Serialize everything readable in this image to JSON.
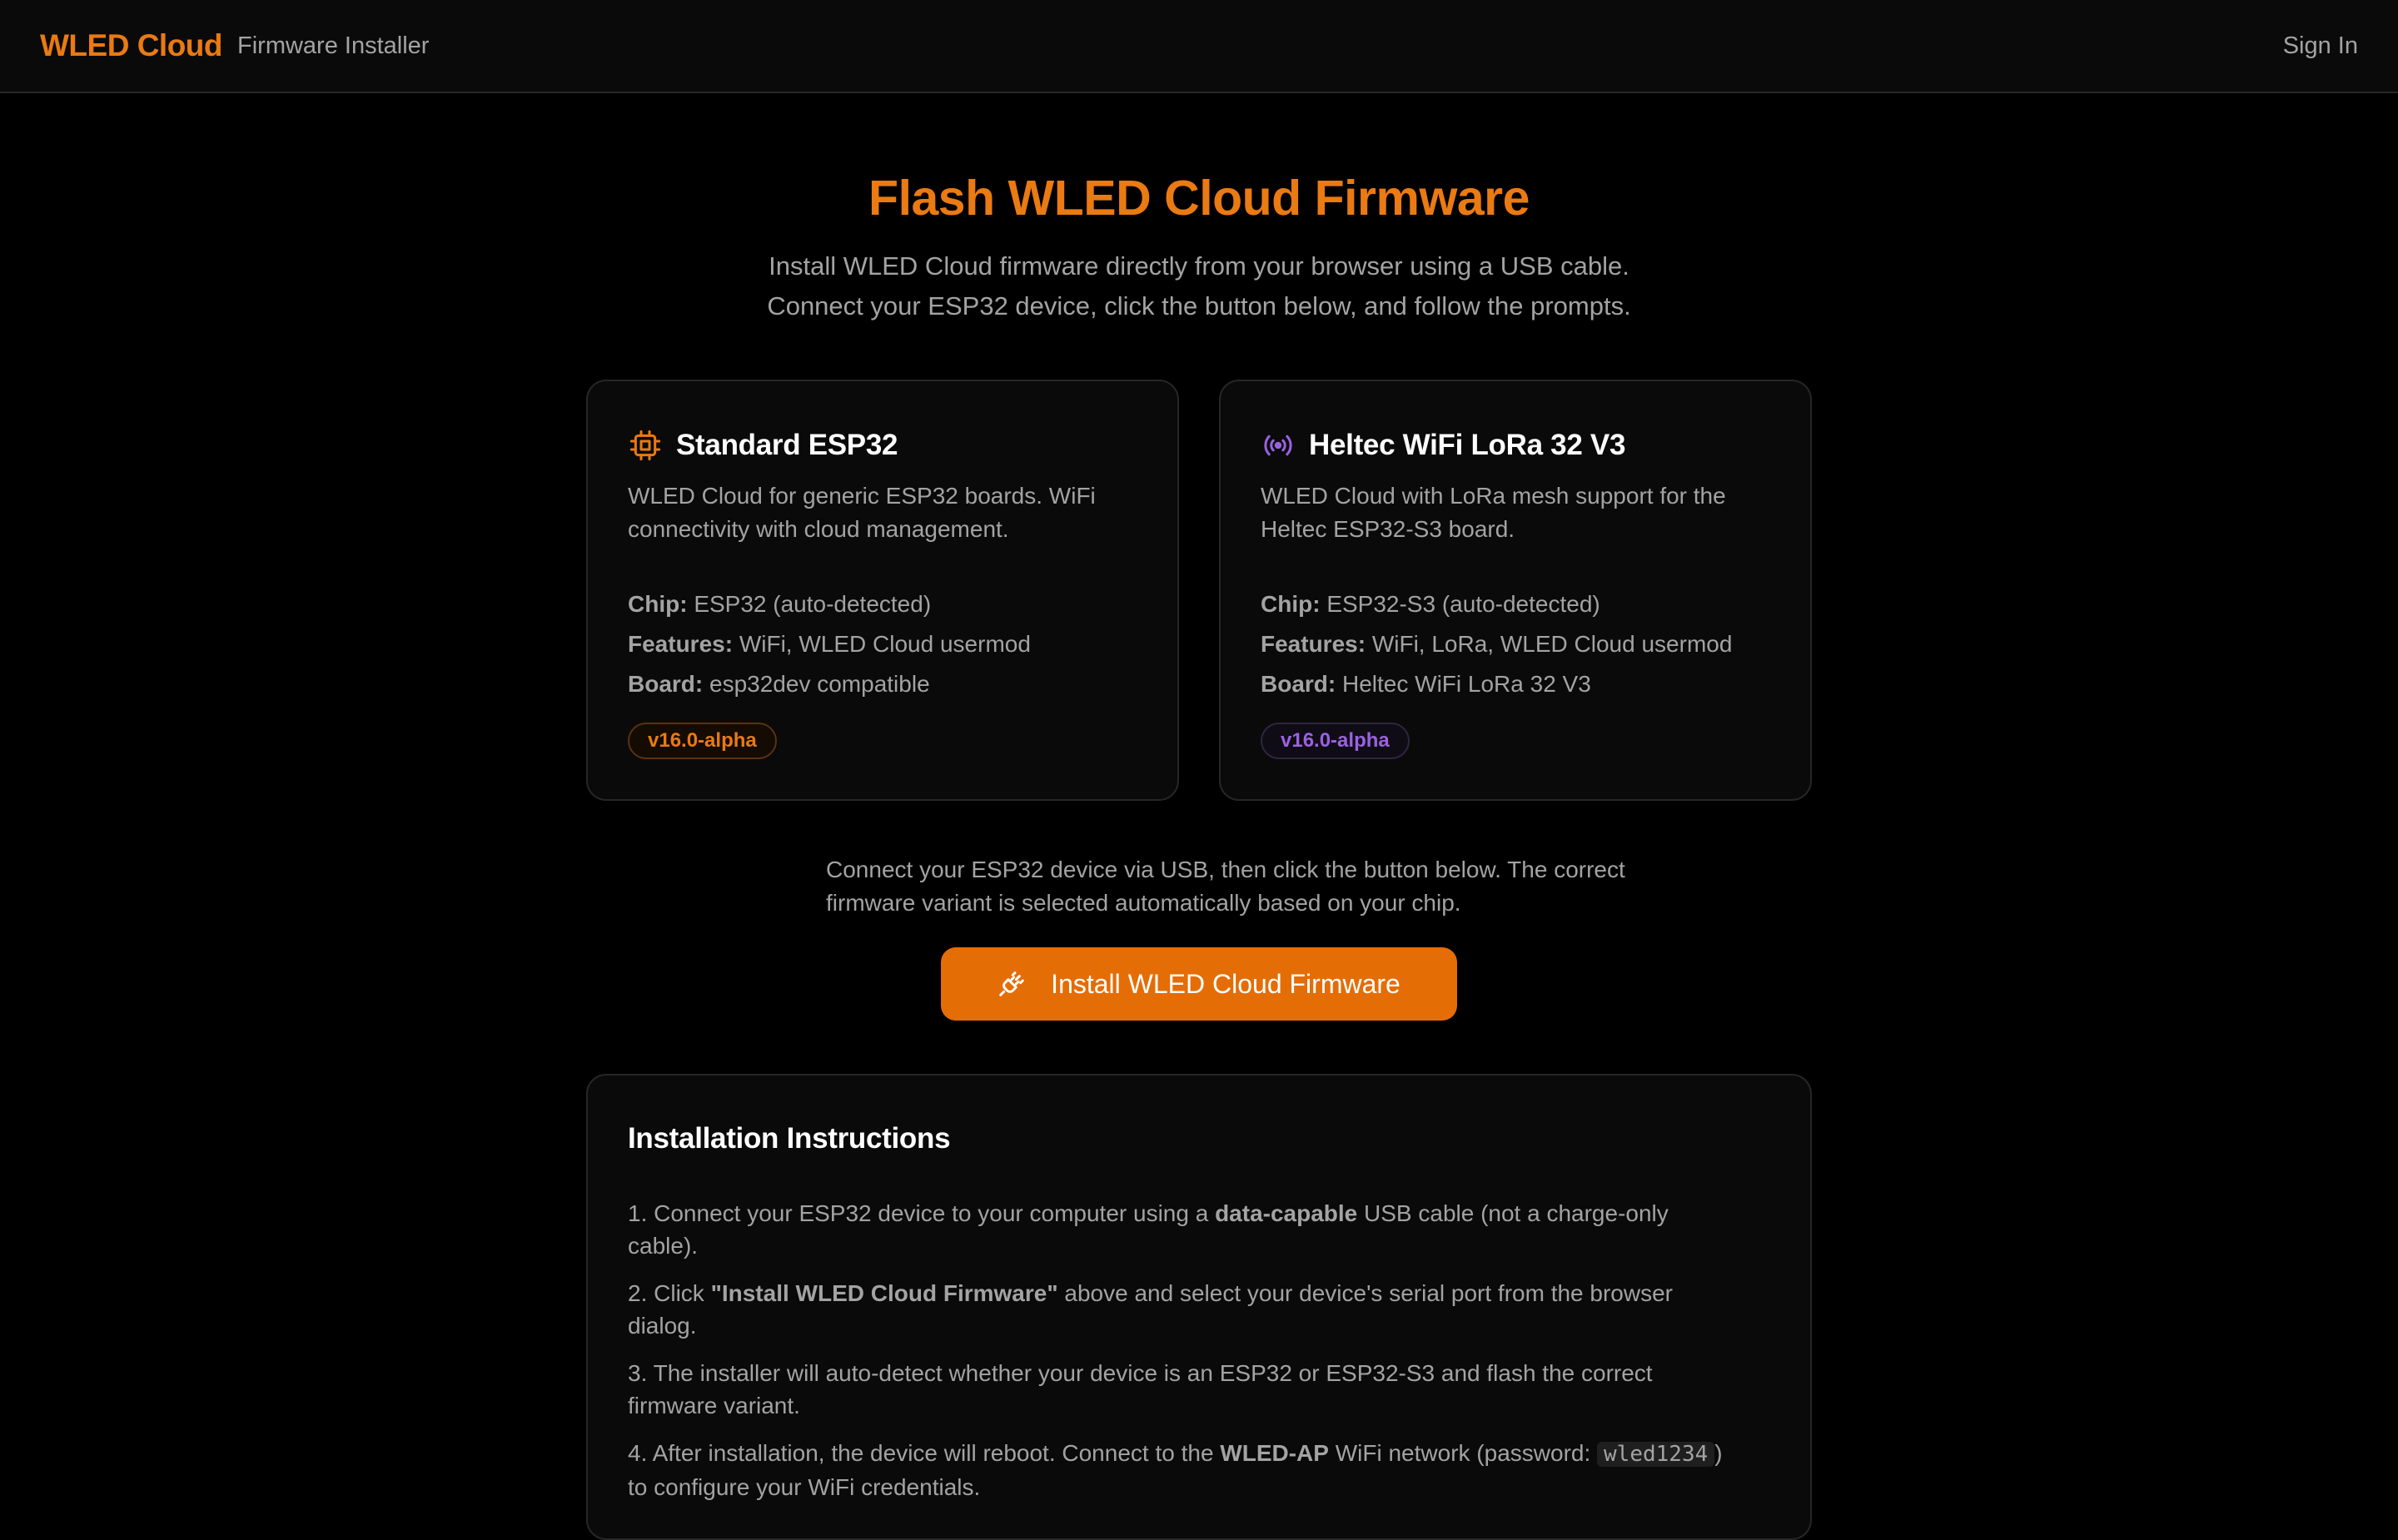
{
  "header": {
    "brand": "WLED Cloud",
    "subtitle": "Firmware Installer",
    "signin": "Sign In"
  },
  "hero": {
    "title": "Flash WLED Cloud Firmware",
    "line1": "Install WLED Cloud firmware directly from your browser using a USB cable.",
    "line2": "Connect your ESP32 device, click the button below, and follow the prompts."
  },
  "cards": [
    {
      "icon": "chip-icon",
      "title": "Standard ESP32",
      "desc": "WLED Cloud for generic ESP32 boards. WiFi connectivity with cloud management.",
      "chip_label": "Chip:",
      "chip": "ESP32 (auto-detected)",
      "features_label": "Features:",
      "features": "WiFi, WLED Cloud usermod",
      "board_label": "Board:",
      "board": "esp32dev compatible",
      "version": "v16.0-alpha",
      "accent": "#ea7a12"
    },
    {
      "icon": "radio-signal-icon",
      "title": "Heltec WiFi LoRa 32 V3",
      "desc": "WLED Cloud with LoRa mesh support for the Heltec ESP32-S3 board.",
      "chip_label": "Chip:",
      "chip": "ESP32-S3 (auto-detected)",
      "features_label": "Features:",
      "features": "WiFi, LoRa, WLED Cloud usermod",
      "board_label": "Board:",
      "board": "Heltec WiFi LoRa 32 V3",
      "version": "v16.0-alpha",
      "accent": "#9a62e0"
    }
  ],
  "note": "Connect your ESP32 device via USB, then click the button below. The correct firmware variant is selected automatically based on your chip.",
  "install_button": "Install WLED Cloud Firmware",
  "instructions": {
    "title": "Installation Instructions",
    "step1_a": "1. Connect your ESP32 device to your computer using a ",
    "step1_b": "data-capable",
    "step1_c": " USB cable (not a charge-only cable).",
    "step2_a": "2. Click ",
    "step2_b": "\"Install WLED Cloud Firmware\"",
    "step2_c": " above and select your device's serial port from the browser dialog.",
    "step3": "3. The installer will auto-detect whether your device is an ESP32 or ESP32-S3 and flash the correct firmware variant.",
    "step4_a": "4. After installation, the device will reboot. Connect to the ",
    "step4_b": "WLED-AP",
    "step4_c": " WiFi network (password: ",
    "step4_code": "wled1234",
    "step4_d": ") to configure your WiFi credentials."
  },
  "colors": {
    "accent": "#ea7a12",
    "button": "#e46d06",
    "lora_accent": "#9a62e0",
    "background": "#000000"
  }
}
